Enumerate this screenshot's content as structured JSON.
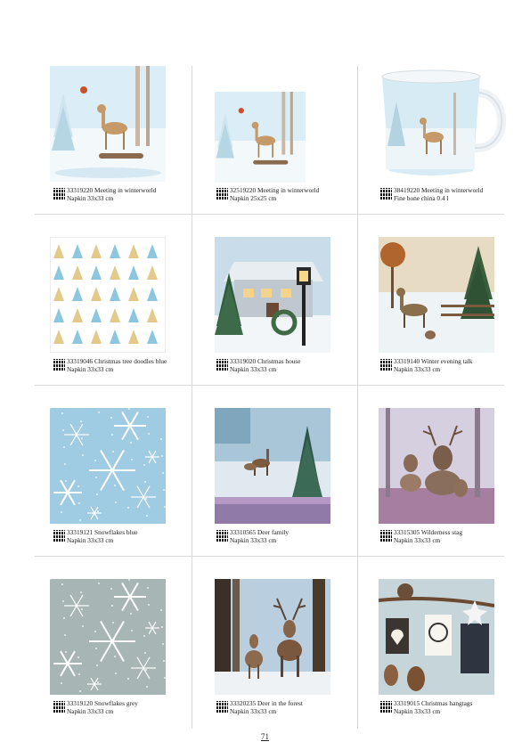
{
  "page": {
    "number": "71"
  },
  "colors": {
    "winter_blue": "#bcdcec",
    "snow": "#f4f8fb",
    "forest": "#2f5a3a",
    "deer": "#b98856",
    "grey": "#a9b6b6"
  },
  "products": [
    {
      "code": "33319220",
      "name": "Meeting in winterworld",
      "spec": "Napkin 33x33 cm",
      "image": "deer-winter-scene"
    },
    {
      "code": "32519220",
      "name": "Meeting in winterworld",
      "spec": "Napkin 25x25 cm",
      "image": "deer-winter-scene"
    },
    {
      "code": "38419220",
      "name": "Meeting in winterworld",
      "spec": "Fine bone china 0.4 l",
      "image": "mug"
    },
    {
      "code": "33319046",
      "name": "Christmas tree doodles blue",
      "spec": "Napkin 33x33 cm",
      "image": "tree-doodles"
    },
    {
      "code": "33319020",
      "name": "Christmas house",
      "spec": "Napkin 33x33 cm",
      "image": "house-lantern"
    },
    {
      "code": "33319140",
      "name": "Winter evening talk",
      "spec": "Napkin 33x33 cm",
      "image": "deer-rabbit"
    },
    {
      "code": "33319121",
      "name": "Snowflakes blue",
      "spec": "Napkin 33x33 cm",
      "image": "snowflakes-blue"
    },
    {
      "code": "33310565",
      "name": "Deer family",
      "spec": "Napkin 33x33 cm",
      "image": "deer-family"
    },
    {
      "code": "33315305",
      "name": "Wilderness stag",
      "spec": "Napkin 33x33 cm",
      "image": "stags"
    },
    {
      "code": "33319120",
      "name": "Snowflakes grey",
      "spec": "Napkin 33x33 cm",
      "image": "snowflakes-grey"
    },
    {
      "code": "33320235",
      "name": "Deer in the forest",
      "spec": "Napkin 33x33 cm",
      "image": "deer-forest"
    },
    {
      "code": "33319015",
      "name": "Christmas hangtags",
      "spec": "Napkin 33x33 cm",
      "image": "hangtags"
    }
  ]
}
